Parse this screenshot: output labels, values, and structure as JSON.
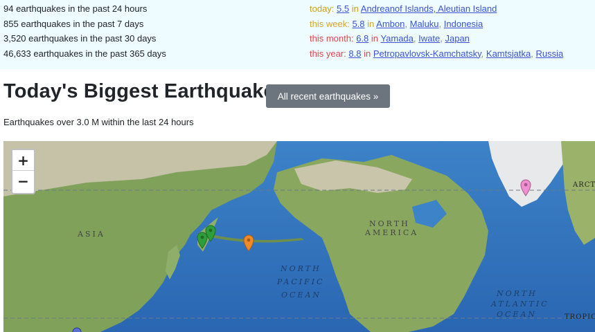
{
  "stats": {
    "counts": [
      "94 earthquakes in the past 24 hours",
      "855 earthquakes in the past 7 days",
      "3,520 earthquakes in the past 30 days",
      "46,633 earthquakes in the past 365 days"
    ],
    "today": {
      "label": "today:",
      "mag": "5.5",
      "in": "in",
      "places": [
        "Andreanof Islands, Aleutian Island"
      ]
    },
    "week": {
      "label": "this week:",
      "mag": "5.8",
      "in": "in",
      "places": [
        "Ambon",
        "Maluku",
        "Indonesia"
      ]
    },
    "month": {
      "label": "this month:",
      "mag": "6.8",
      "in": "in",
      "places": [
        "Yamada",
        "Iwate",
        "Japan"
      ]
    },
    "year": {
      "label": "this year:",
      "mag": "8.8",
      "in": "in",
      "places": [
        "Petropavlovsk-Kamchatsky",
        "Kamtsjatka",
        "Russia"
      ]
    }
  },
  "heading": {
    "title": "Today's Biggest Earthquakes",
    "button": "All recent earthquakes »",
    "subtitle": "Earthquakes over 3.0 M within the last 24 hours"
  },
  "map": {
    "zoom_in": "+",
    "zoom_out": "−",
    "labels": {
      "asia": "ASIA",
      "north_america_1": "NORTH",
      "north_america_2": "AMERICA",
      "pacific_1": "NORTH",
      "pacific_2": "PACIFIC",
      "pacific_3": "OCEAN",
      "atlantic_1": "NORTH",
      "atlantic_2": "ATLANTIC",
      "atlantic_3": "OCEAN",
      "arctic": "ARCTI",
      "tropic": "TROPIC"
    },
    "marker_colors": {
      "green": "#2e9e3a",
      "orange": "#ef8a2a",
      "pink": "#f08fd0",
      "blue": "#5a6fd0"
    }
  }
}
